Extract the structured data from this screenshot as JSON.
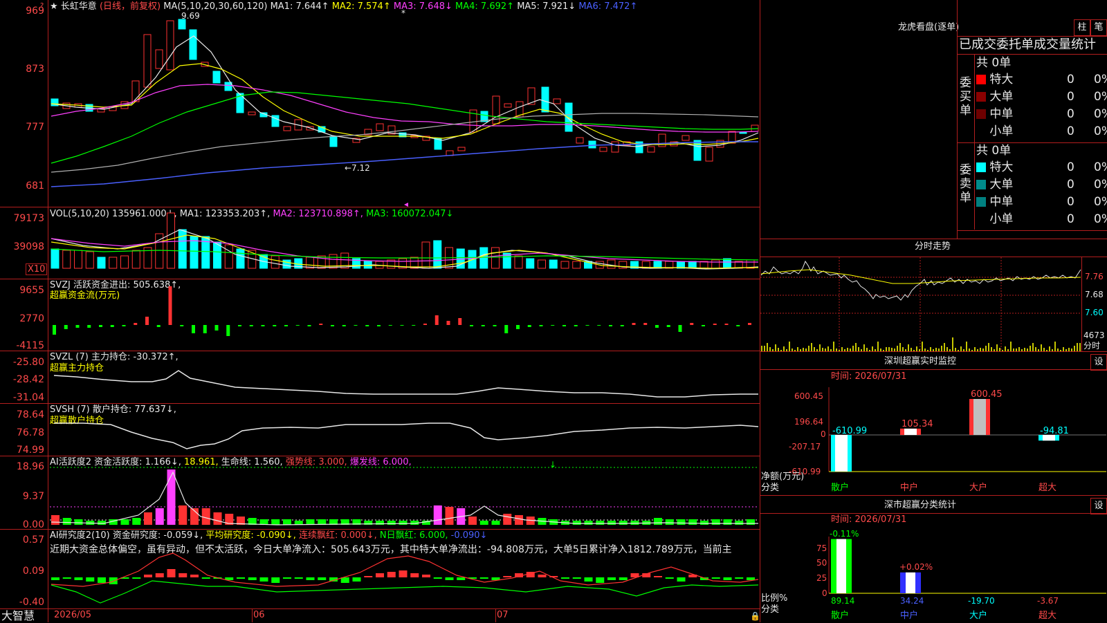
{
  "colors": {
    "up": "#ff3232",
    "down": "#00ffff",
    "border": "#b41e1e",
    "ma1": "#e8e8e8",
    "ma2": "#ffff00",
    "ma3": "#ff40ff",
    "ma4": "#00ff00",
    "ma5": "#b0b0b0",
    "ma6": "#4a60ff"
  },
  "header": {
    "star": "★",
    "stock_name": "长虹华意",
    "mode": "(日线，前复权)",
    "ma_params": "MA(5,10,20,30,60,120)",
    "ma1": "MA1: 7.644↑",
    "ma2": "MA2: 7.574↑",
    "ma3": "MA3: 7.648↓",
    "ma4": "MA4: 7.692↑",
    "ma5": "MA5: 7.921↓",
    "ma6": "MA6: 7.472↑",
    "high_label": "9.69",
    "low_label": "←7.12",
    "dot": "*"
  },
  "price_axis": [
    "969",
    "873",
    "777",
    "681"
  ],
  "vol": {
    "title": "VOL(5,10,20)",
    "value": "135961.000↓,",
    "ma1": "MA1: 123353.203↑,",
    "ma2": "MA2: 123710.898↑,",
    "ma3": "MA3: 160072.047↓",
    "axis": [
      "79173",
      "39098"
    ],
    "unit": "X10"
  },
  "svzj": {
    "title": "SVZJ  活跃资金进出: 505.638↑,",
    "subtitle": "超赢资金流(万元)",
    "axis": [
      "9655",
      "2770",
      "-4115"
    ]
  },
  "svzl": {
    "title": "SVZL (7) 主力持仓: -30.372↑,",
    "subtitle": "超赢主力持仓",
    "axis": [
      "-25.80",
      "-28.42",
      "-31.04"
    ]
  },
  "svsh": {
    "title": "SVSH (7) 散户持仓: 77.637↓,",
    "subtitle": "超赢散户持仓",
    "axis": [
      "78.64",
      "76.78",
      "74.99"
    ]
  },
  "ai1": {
    "title": "AI活跃度2 资金活跃度: 1.166↓,",
    "v2": "18.961,",
    "v3": "生命线: 1.560,",
    "v4": "强势线: 3.000,",
    "v5": "爆发线: 6.000,",
    "axis": [
      "18.96",
      "9.37",
      "0.00"
    ]
  },
  "ai2": {
    "title": "AI研究度2(10) 资金研究度: -0.059↓,",
    "v2": "平均研究度: -0.090↓,",
    "v3": "连续飘红: 0.000↓,",
    "v4": "N日飘红: 6.000,",
    "v5": "-0.090↓",
    "text": "近期大资金总体偏空，虽有异动，但不太活跃，今日大单净流入：505.643万元，其中特大单净流出：-94.808万元，大单5日累计净入1812.789万元，当前主",
    "axis": [
      "0.57",
      "0.09",
      "-0.40"
    ]
  },
  "xaxis": [
    "2026/05",
    "06",
    "07"
  ],
  "brand": "大智慧",
  "right": {
    "lhb_title": "龙虎看盘(逐单)",
    "btn_bar": "柱",
    "btn_pen": "笔",
    "tabs": "已成交委托单成交量统计",
    "buy": {
      "side": [
        "委",
        "买",
        "单"
      ],
      "total": "共 0单",
      "rows": [
        {
          "label": "特大",
          "count": "0",
          "pct": "0%",
          "color": "#ff0000"
        },
        {
          "label": "大单",
          "count": "0",
          "pct": "0%",
          "color": "#8b0000"
        },
        {
          "label": "中单",
          "count": "0",
          "pct": "0%",
          "color": "#6e0000"
        },
        {
          "label": "小单",
          "count": "0",
          "pct": "0%",
          "color": "#000000"
        }
      ]
    },
    "sell": {
      "side": [
        "委",
        "卖",
        "单"
      ],
      "total": "共 0单",
      "rows": [
        {
          "label": "特大",
          "count": "0",
          "pct": "0%",
          "color": "#00ffff"
        },
        {
          "label": "大单",
          "count": "0",
          "pct": "0%",
          "color": "#008b8b"
        },
        {
          "label": "中单",
          "count": "0",
          "pct": "0%",
          "color": "#008080"
        },
        {
          "label": "小单",
          "count": "0",
          "pct": "0%",
          "color": "#000000"
        }
      ]
    },
    "fs_title": "分时走势",
    "fs_axis": [
      "7.76",
      "7.68",
      "7.60"
    ],
    "fs_vol": "4673",
    "fs_unit": "分时",
    "sz_title": "深圳超赢实时监控",
    "sz_btn": "设",
    "time1": "时间: 2026/07/31",
    "sz_axis": [
      "600.45",
      "196.64",
      "0",
      "-207.17",
      "-610.99"
    ],
    "sz_bars": [
      {
        "cat": "散户",
        "value": -610.99
      },
      {
        "cat": "中户",
        "value": 105.34
      },
      {
        "cat": "大户",
        "value": 600.45
      },
      {
        "cat": "超大",
        "value": -94.81
      }
    ],
    "sz_labels": [
      "-610.99",
      "105.34",
      "600.45",
      "-94.81"
    ],
    "sz_unit": "净额(万元)",
    "sz_cls": "分类",
    "ss_title": "深市超赢分类统计",
    "ss_btn": "设",
    "time2": "时间: 2026/07/31",
    "ss_axis": [
      "75",
      "50",
      "25",
      "0"
    ],
    "ss_top": [
      "-0.11%",
      "+0.02%"
    ],
    "ss_vals": [
      "89.14",
      "34.24",
      "-19.70",
      "-3.67"
    ],
    "ss_unit": "比例%",
    "ss_cls": "分类",
    "cats": [
      "散户",
      "中户",
      "大户",
      "超大"
    ]
  }
}
